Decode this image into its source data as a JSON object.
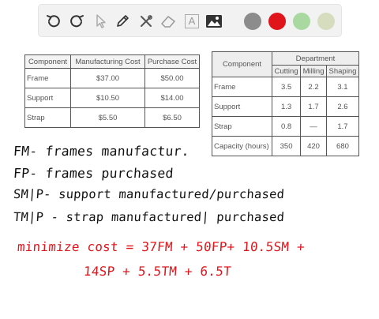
{
  "toolbar": {
    "tools": [
      "undo-icon",
      "redo-icon",
      "pointer-icon",
      "pencil-icon",
      "tools-icon",
      "eraser-icon",
      "text-icon",
      "image-icon"
    ],
    "colors": [
      "#8c8c8c",
      "#e0141b",
      "#a9d9a0",
      "#d5ddbe"
    ],
    "text_tool_label": "A"
  },
  "cost_table": {
    "headers": [
      "Component",
      "Manufacturing Cost",
      "Purchase Cost"
    ],
    "rows": [
      [
        "Frame",
        "$37.00",
        "$50.00"
      ],
      [
        "Support",
        "$10.50",
        "$14.00"
      ],
      [
        "Strap",
        "$5.50",
        "$6.50"
      ]
    ]
  },
  "dept_table": {
    "component_header": "Component",
    "group_header": "Department",
    "sub_headers": [
      "Cutting",
      "Milling",
      "Shaping"
    ],
    "rows": [
      [
        "Frame",
        "3.5",
        "2.2",
        "3.1"
      ],
      [
        "Support",
        "1.3",
        "1.7",
        "2.6"
      ],
      [
        "Strap",
        "0.8",
        "—",
        "1.7"
      ],
      [
        "Capacity (hours)",
        "350",
        "420",
        "680"
      ]
    ]
  },
  "notes": {
    "line1": "FM- frames manufactur.",
    "line2": "FP- frames purchased",
    "line3": "SM|P- support manufactured/purchased",
    "line4": "TM|P - strap manufactured| purchased",
    "line5": "minimize cost = 37FM + 50FP+ 10.5SM +",
    "line6": "14SP + 5.5TM + 6.5T"
  }
}
